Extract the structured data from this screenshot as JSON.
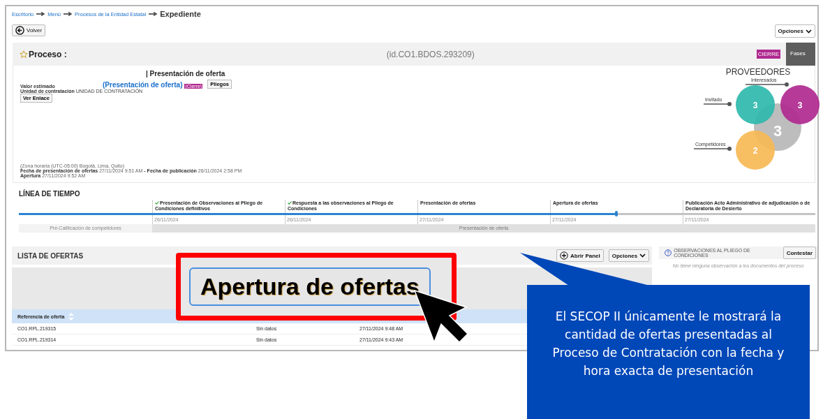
{
  "breadcrumb": [
    {
      "label": "Escritorio",
      "kind": "link"
    },
    {
      "label": "Menú",
      "kind": "link"
    },
    {
      "label": "Procesos de la Entidad Estatal",
      "kind": "link"
    },
    {
      "label": "Expediente",
      "kind": "current"
    }
  ],
  "back_button": "Volver",
  "options_button": "Opciones",
  "process": {
    "title": "Proceso :",
    "id": "(id.CO1.BDOS.293209)",
    "status_badge": "CIERRE",
    "phases_button": "Fases"
  },
  "details": {
    "heading": "| Presentación de oferta",
    "phase_link": "(Presentación de oferta)",
    "phase_badge": "(Cierre)",
    "pliegos_button": "Pliegos",
    "estimated_value_label": "Valor estimado",
    "unit_label": "Unidad de contratación",
    "unit_value": "UNIDAD DE CONTRATACIÓN",
    "link_button": "Ver Enlace",
    "timezone": "(Zona horaria (UTC-05:00) Bogotá, Lima, Quito)",
    "dates_line": "**Fecha de presentación de ofertas** 27/11/2024 9:51 AM **-** **Fecha de publicación** 26/11/2024 2:58 PM",
    "opening_line": "**Apertura** 27/11/2024 9:52 AM"
  },
  "providers": {
    "title": "PROVEEDORES",
    "total": "3",
    "groups": [
      {
        "label": "Interesados",
        "count": "3",
        "color": "#b0298f"
      },
      {
        "label": "Invitado",
        "count": "3",
        "color": "#2fb8ac"
      },
      {
        "label": "Competidores",
        "count": "2",
        "color": "#f7b955"
      }
    ]
  },
  "timeline": {
    "title": "LÍNEA DE TIEMPO",
    "level": 0.75,
    "milestones": [
      {
        "label": "Presentación de Observaciones al Pliego de Condiciones definitivos",
        "date": "26/11/2024",
        "done": true
      },
      {
        "label": "Respuesta a las observaciones al Pliego de Condiciones",
        "date": "26/11/2024",
        "done": true
      },
      {
        "label": "Presentación de ofertas",
        "date": "27/11/2024",
        "done": false
      },
      {
        "label": "Apertura de ofertas",
        "date": "27/11/2024",
        "done": false
      },
      {
        "label": "Publicación Acto Administrativo de adjudicación o de Declaratoria de Desierto",
        "date": "27/11/2024",
        "done": false
      }
    ],
    "phases": [
      {
        "label": "Pré-Calificación de competidores",
        "selected": false
      },
      {
        "label": "Presentación de oferta",
        "selected": true
      }
    ]
  },
  "offers": {
    "title": "LISTA DE OFERTAS",
    "open_panel_button": "Abrir Panel",
    "options_button": "Opciones",
    "column_1": "Referencia de oferta",
    "rows": [
      {
        "reference": "CO1.RPL.219315",
        "status": "Sin datos",
        "date": "27/11/2024 9:48 AM"
      },
      {
        "reference": "CO1.RPL.219314",
        "status": "Sin datos",
        "date": "27/11/2024 9:43 AM"
      }
    ]
  },
  "observations": {
    "title": "OBSERVACIONES AL PLIEGO DE CONDICIONES",
    "button": "Contestar",
    "empty_text": "No tiene ninguna observación a los documentos del proceso"
  },
  "annotation": {
    "zoomed_button": "Apertura de ofertas",
    "callout": "El SECOP II únicamente le mostrará la cantidad de ofertas presentadas al Proceso de Contratación con la fecha y hora exacta de presentación"
  }
}
